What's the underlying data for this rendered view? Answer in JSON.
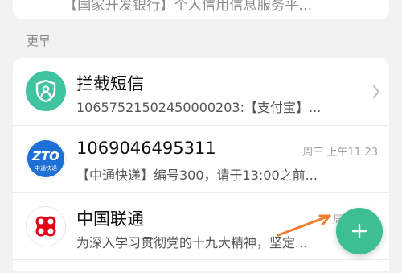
{
  "top_item": {
    "preview": "【国家开发银行】个人信用信息服务平..."
  },
  "section": {
    "label": "更早"
  },
  "messages": [
    {
      "title": "拦截短信",
      "preview": "10657521502450000203:【支付宝】...",
      "timestamp": "",
      "avatar_icon": "shield-user-icon",
      "avatar_color": "#3fc3a0"
    },
    {
      "title": "1069046495311",
      "preview": "【中通快递】编号300，请于13:00之前...",
      "timestamp": "周三 上午11:23",
      "avatar_icon": "zto-logo-icon",
      "avatar_text": "中通快递",
      "avatar_color": "#1e6fd6"
    },
    {
      "title": "中国联通",
      "preview": "为深入学习贯彻党的十九大精神，坚定...",
      "timestamp": "周一 下午",
      "avatar_icon": "china-unicom-logo-icon",
      "avatar_color": "#e60012"
    }
  ],
  "fab": {
    "icon": "plus-icon",
    "color": "#3dbf8f"
  },
  "colors": {
    "accent": "#3dbf8f",
    "annotation_arrow": "#f07c2e"
  }
}
